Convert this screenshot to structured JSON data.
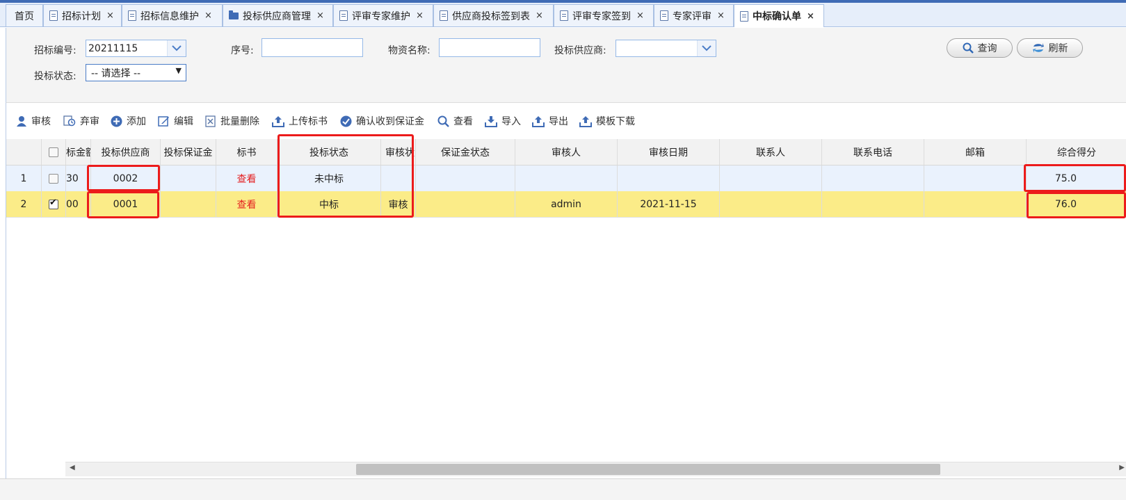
{
  "tabs": [
    {
      "label": "首页",
      "icon": "none"
    },
    {
      "label": "招标计划",
      "icon": "document-icon"
    },
    {
      "label": "招标信息维护",
      "icon": "document-icon"
    },
    {
      "label": "投标供应商管理",
      "icon": "folder-icon"
    },
    {
      "label": "评审专家维护",
      "icon": "document-icon"
    },
    {
      "label": "供应商投标签到表",
      "icon": "document-icon"
    },
    {
      "label": "评审专家签到",
      "icon": "document-icon"
    },
    {
      "label": "专家评审",
      "icon": "document-icon"
    },
    {
      "label": "中标确认单",
      "icon": "document-icon"
    }
  ],
  "tab_close": "×",
  "search": {
    "bid_no_label": "招标编号:",
    "bid_no_value": "20211115",
    "seq_label": "序号:",
    "material_label": "物资名称:",
    "supplier_label": "投标供应商:",
    "status_label": "投标状态:",
    "status_value": "-- 请选择 --",
    "query_btn": "查询",
    "refresh_btn": "刷新"
  },
  "toolbar": [
    {
      "label": "审核",
      "icon": "user-icon"
    },
    {
      "label": "弃审",
      "icon": "abandon-review-icon"
    },
    {
      "label": "添加",
      "icon": "add-icon"
    },
    {
      "label": "编辑",
      "icon": "edit-icon"
    },
    {
      "label": "批量删除",
      "icon": "batch-delete-icon"
    },
    {
      "label": "上传标书",
      "icon": "upload-icon"
    },
    {
      "label": "确认收到保证金",
      "icon": "check-icon"
    },
    {
      "label": "查看",
      "icon": "search-icon"
    },
    {
      "label": "导入",
      "icon": "import-icon"
    },
    {
      "label": "导出",
      "icon": "export-icon"
    },
    {
      "label": "模板下载",
      "icon": "template-download-icon"
    }
  ],
  "grid": {
    "columns": [
      "",
      "",
      "标金额",
      "投标供应商",
      "投标保证金",
      "标书",
      "投标状态",
      "审核状",
      "保证金状态",
      "审核人",
      "审核日期",
      "联系人",
      "联系电话",
      "邮箱",
      "综合得分"
    ],
    "rows": [
      {
        "num": "1",
        "checked": false,
        "amount": "30",
        "supplier": "0002",
        "deposit": "",
        "doc": "查看",
        "status": "未中标",
        "review": "",
        "deposit_status": "",
        "reviewer": "",
        "review_date": "",
        "contact": "",
        "phone": "",
        "email": "",
        "score": "75.0"
      },
      {
        "num": "2",
        "checked": true,
        "amount": "00",
        "supplier": "0001",
        "deposit": "",
        "doc": "查看",
        "status": "中标",
        "review": "审核",
        "deposit_status": "",
        "reviewer": "admin",
        "review_date": "2021-11-15",
        "contact": "",
        "phone": "",
        "email": "",
        "score": "76.0"
      }
    ]
  },
  "colors": {
    "accent": "#3f6bb5",
    "highlight_row": "#fbec88",
    "selected_row": "#eaf2fd",
    "annotation_red": "#ec1b1b",
    "link_red": "#e41f1f"
  }
}
